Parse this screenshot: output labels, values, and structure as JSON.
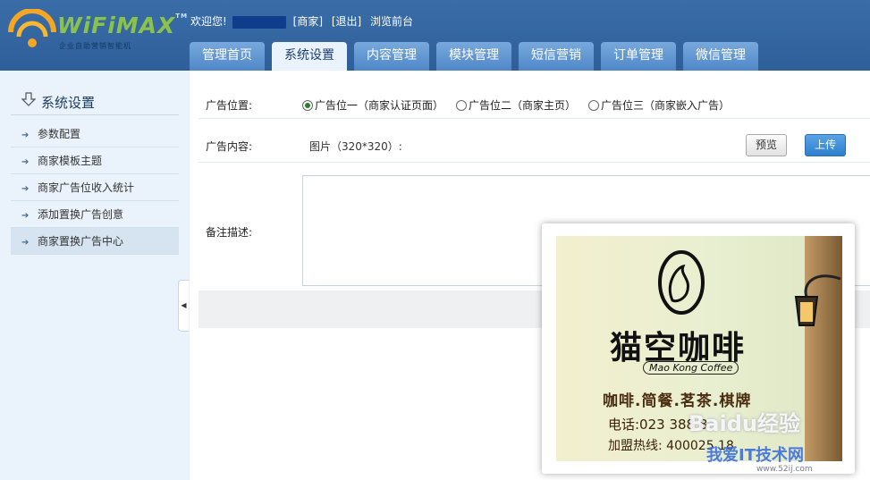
{
  "header": {
    "logo_text": "WiFiMAX",
    "logo_tm": "TM",
    "logo_subtitle": "企业自助营销智能机",
    "welcome": "欢迎您!",
    "links": [
      "[商家]",
      "[退出]",
      "浏览前台"
    ]
  },
  "nav_tabs": [
    "管理首页",
    "系统设置",
    "内容管理",
    "模块管理",
    "短信营销",
    "订单管理",
    "微信管理"
  ],
  "sidebar": {
    "title": "系统设置",
    "items": [
      "参数配置",
      "商家模板主题",
      "商家广告位收入统计",
      "添加置换广告创意",
      "商家置换广告中心"
    ]
  },
  "form": {
    "position_label": "广告位置:",
    "position_options": [
      "广告位一（商家认证页面）",
      "广告位二（商家主页）",
      "广告位三（商家嵌入广告）"
    ],
    "content_label": "广告内容:",
    "image_hint": "图片（320*320）:",
    "preview_button": "预览",
    "upload_button": "上传",
    "note_label": "备注描述:"
  },
  "ad_preview": {
    "title": "猫空咖啡",
    "english": "Mao Kong Coffee",
    "menu": "咖啡.简餐.茗茶.棋牌",
    "phone": "电话:023 388  8",
    "franchise": "加盟热线: 400025  18"
  },
  "watermarks": [
    "Baidu经验",
    "我爱IT技术网",
    "www.52ij.com"
  ],
  "colors": {
    "header_bg": "#3a6da8",
    "sidebar_bg": "#eaf3fb",
    "upload_btn": "#2d7fcc"
  }
}
